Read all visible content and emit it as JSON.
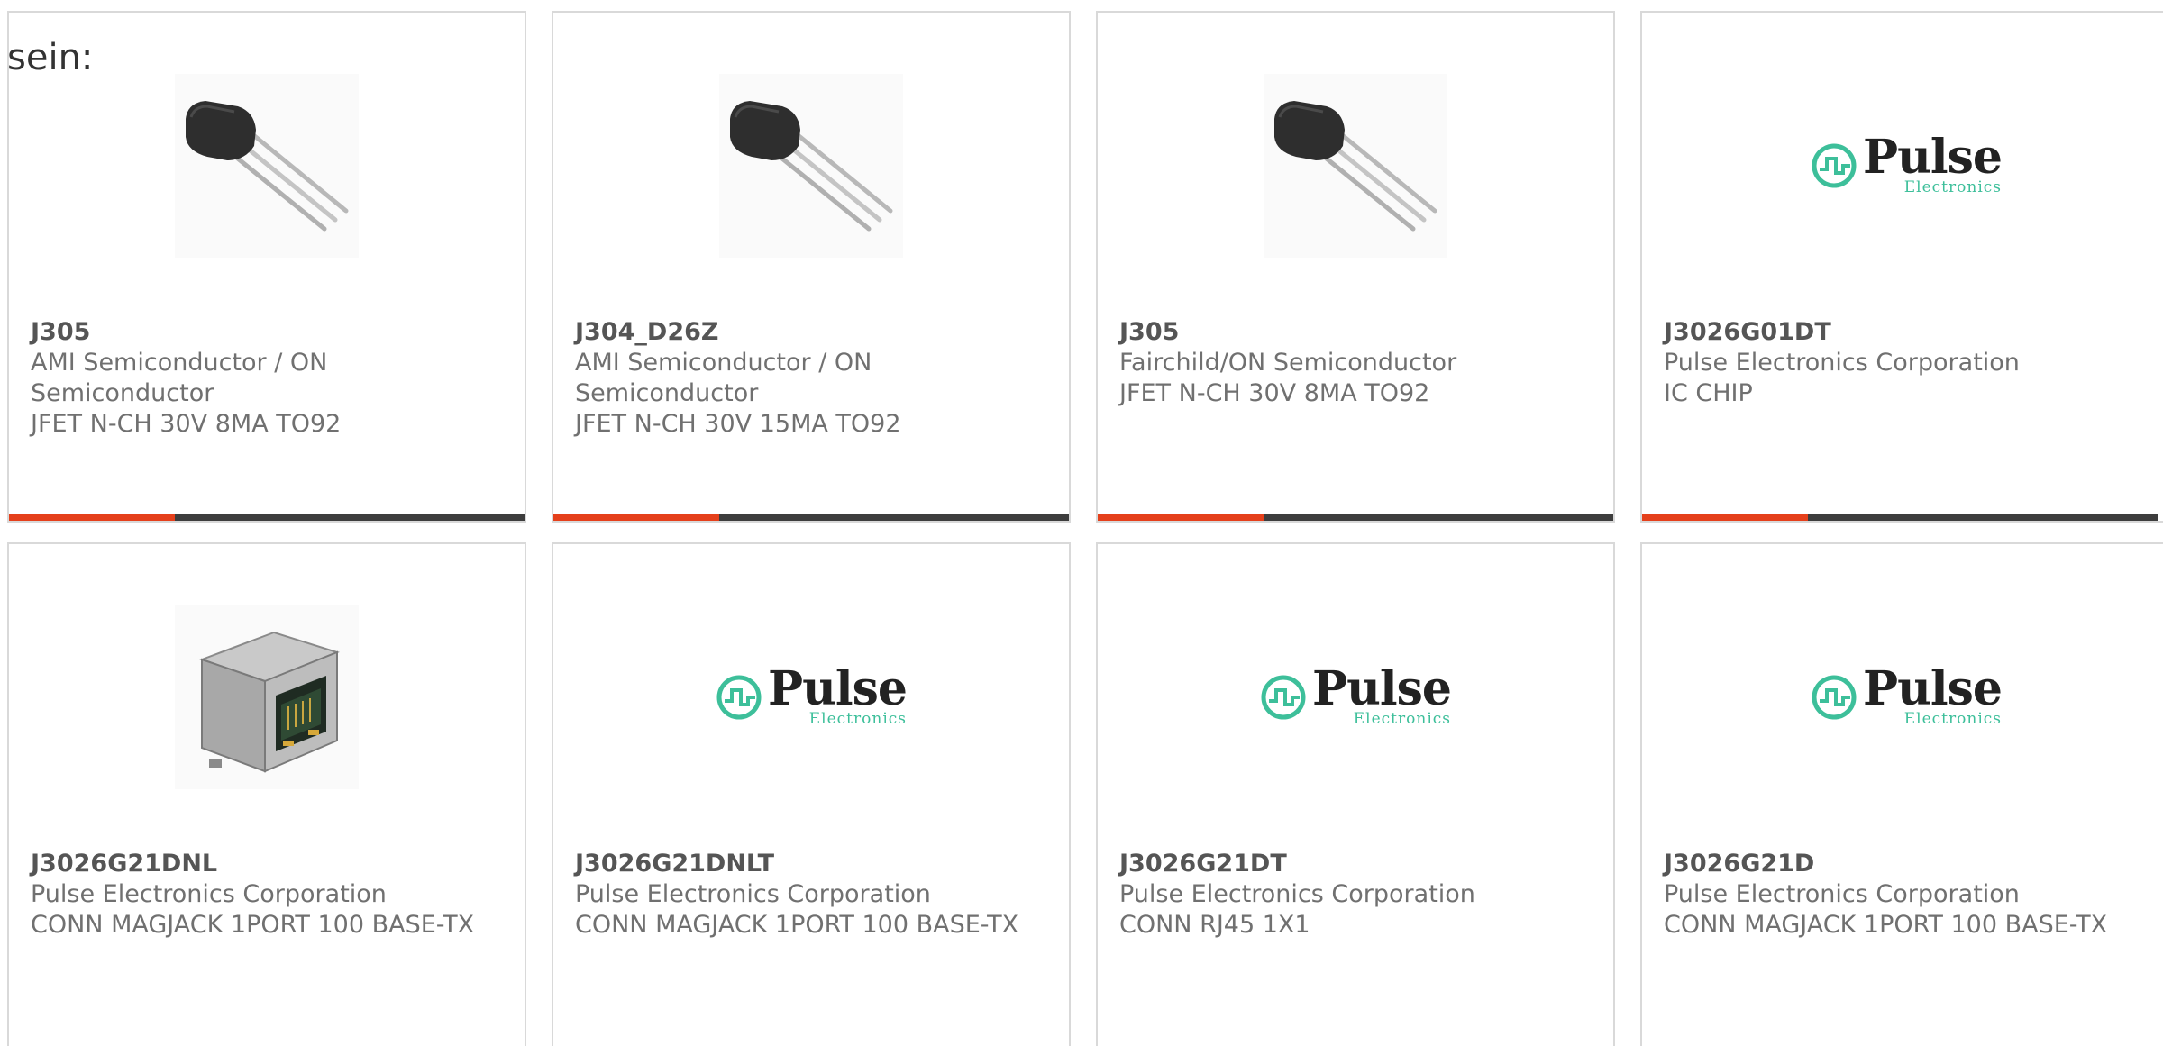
{
  "stray_text": "sein:",
  "colors": {
    "accent_bar": "#e5401b",
    "dark_bar": "#3d3d3d",
    "pulse_teal": "#3dbf9a",
    "card_border": "#d9d9d9"
  },
  "cards": [
    {
      "image": "transistor-image",
      "part_number": "J305",
      "manufacturer": "AMI Semiconductor / ON Semiconductor",
      "description": "JFET N-CH 30V 8MA TO92"
    },
    {
      "image": "transistor-image",
      "part_number": "J304_D26Z",
      "manufacturer": "AMI Semiconductor / ON Semiconductor",
      "description": "JFET N-CH 30V 15MA TO92"
    },
    {
      "image": "transistor-image",
      "part_number": "J305",
      "manufacturer": "Fairchild/ON Semiconductor",
      "description": "JFET N-CH 30V 8MA TO92"
    },
    {
      "image": "pulse-electronics-logo",
      "part_number": "J3026G01DT",
      "manufacturer": "Pulse Electronics Corporation",
      "description": "IC CHIP"
    },
    {
      "image": "rj45-connector-image",
      "part_number": "J3026G21DNL",
      "manufacturer": "Pulse Electronics Corporation",
      "description": "CONN MAGJACK 1PORT 100 BASE-TX"
    },
    {
      "image": "pulse-electronics-logo",
      "part_number": "J3026G21DNLT",
      "manufacturer": "Pulse Electronics Corporation",
      "description": "CONN MAGJACK 1PORT 100 BASE-TX"
    },
    {
      "image": "pulse-electronics-logo",
      "part_number": "J3026G21DT",
      "manufacturer": "Pulse Electronics Corporation",
      "description": "CONN RJ45 1X1"
    },
    {
      "image": "pulse-electronics-logo",
      "part_number": "J3026G21D",
      "manufacturer": "Pulse Electronics Corporation",
      "description": "CONN MAGJACK 1PORT 100 BASE-TX"
    }
  ],
  "pulse_logo": {
    "word": "Pulse",
    "sub": "Electronics"
  }
}
